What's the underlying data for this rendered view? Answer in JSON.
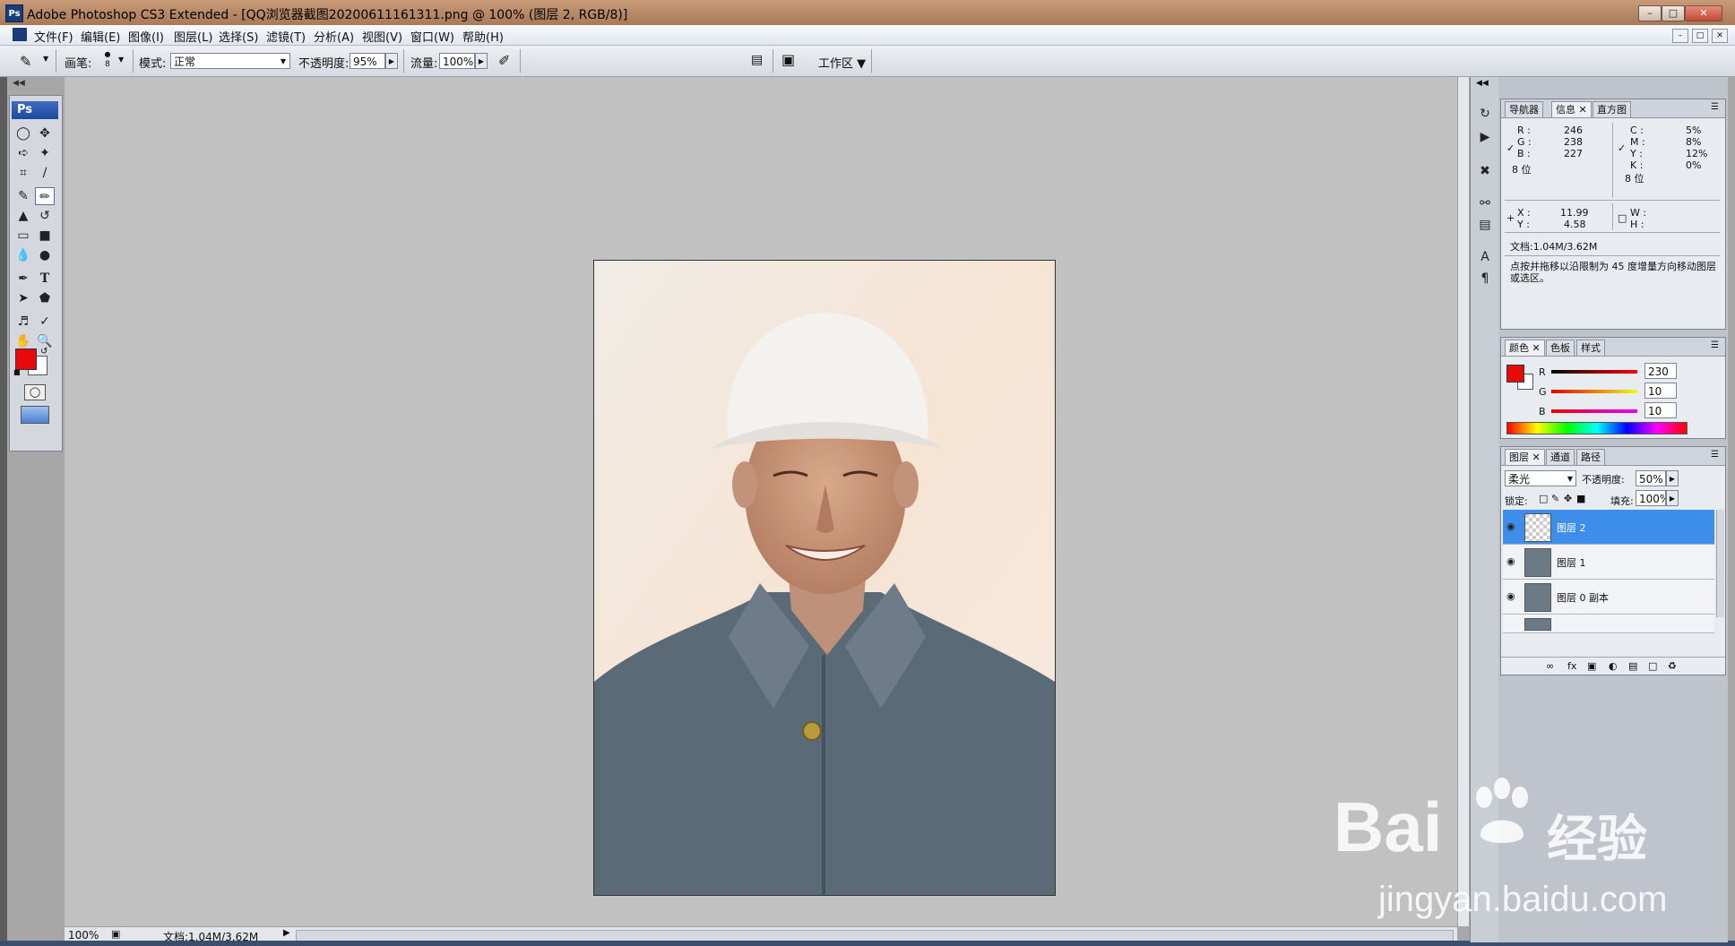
{
  "app": {
    "ps_logo": "Ps",
    "title": "Adobe Photoshop CS3 Extended - [QQ浏览器截图20200611161311.png @ 100% (图层 2, RGB/8)]"
  },
  "menu": [
    "文件(F)",
    "编辑(E)",
    "图像(I)",
    "图层(L)",
    "选择(S)",
    "滤镜(T)",
    "分析(A)",
    "视图(V)",
    "窗口(W)",
    "帮助(H)"
  ],
  "options": {
    "brush_label": "画笔:",
    "brush_size": "8",
    "mode_label": "模式:",
    "mode_value": "正常",
    "opacity_label": "不透明度:",
    "opacity_value": "95%",
    "flow_label": "流量:",
    "flow_value": "100%",
    "workspace_label": "工作区"
  },
  "status": {
    "zoom": "100%",
    "doc_info": "文档:1.04M/3.62M"
  },
  "info_panel": {
    "tabs": [
      "导航器",
      "信息",
      "直方图"
    ],
    "active_tab": "信息",
    "rgb": {
      "R": "246",
      "G": "238",
      "B": "227"
    },
    "cmyk": {
      "C": "5%",
      "M": "8%",
      "Y": "12%",
      "K": "0%"
    },
    "bit_left": "8 位",
    "bit_right": "8 位",
    "xy": {
      "X": "11.99",
      "Y": "4.58"
    },
    "wh_labels": {
      "W": "W :",
      "H": "H :"
    },
    "doc": "文档:1.04M/3.62M",
    "hint": "点按并拖移以沿限制为 45 度增量方向移动图层或选区。"
  },
  "color_panel": {
    "tabs": [
      "颜色",
      "色板",
      "样式"
    ],
    "active_tab": "颜色",
    "R": "230",
    "G": "10",
    "B": "10",
    "foreground_color": "#e60a0a",
    "background_color": "#ffffff"
  },
  "layers_panel": {
    "tabs": [
      "图层",
      "通道",
      "路径"
    ],
    "active_tab": "图层",
    "blend_mode": "柔光",
    "opacity_label": "不透明度:",
    "opacity_value": "50%",
    "lock_label": "锁定:",
    "fill_label": "填充:",
    "fill_value": "100%",
    "layers": [
      {
        "name": "图层 2",
        "selected": true
      },
      {
        "name": "图层 1",
        "selected": false
      },
      {
        "name": "图层 0 副本",
        "selected": false
      }
    ]
  },
  "watermark": {
    "brand": "Bai",
    "brand2": "经验",
    "url": "jingyan.baidu.com"
  }
}
